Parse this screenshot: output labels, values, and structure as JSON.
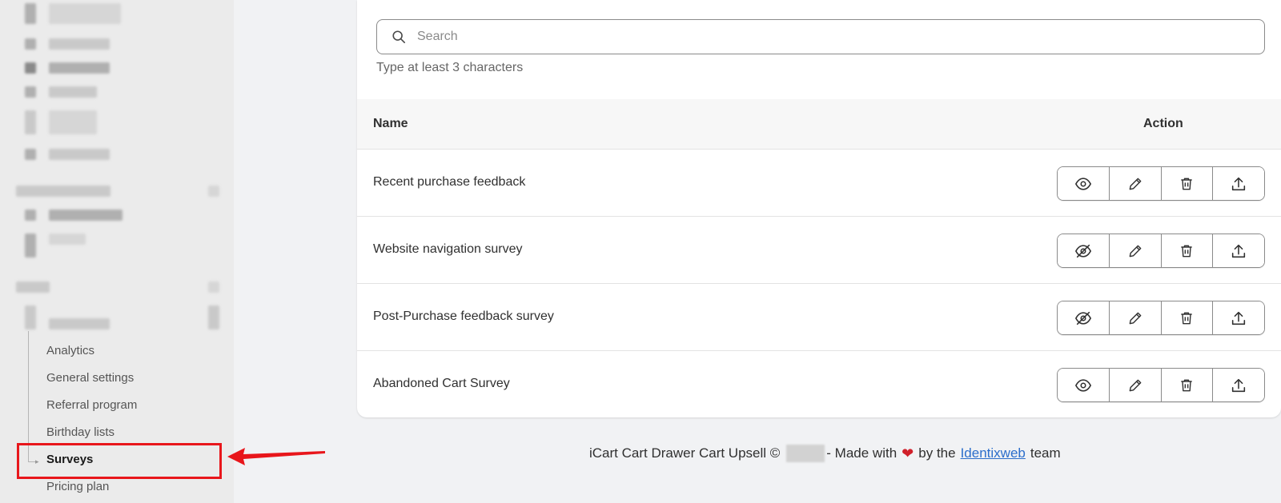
{
  "sidebar": {
    "items": [
      {
        "label": "Analytics"
      },
      {
        "label": "General settings"
      },
      {
        "label": "Referral program"
      },
      {
        "label": "Birthday lists"
      },
      {
        "label": "Surveys"
      },
      {
        "label": "Pricing plan"
      }
    ],
    "active": "Surveys"
  },
  "search": {
    "placeholder": "Search",
    "value": "",
    "hint": "Type at least 3 characters"
  },
  "table": {
    "columns": {
      "name": "Name",
      "action": "Action"
    },
    "rows": [
      {
        "name": "Recent purchase feedback",
        "visible": true
      },
      {
        "name": "Website navigation survey",
        "visible": false
      },
      {
        "name": "Post-Purchase feedback survey",
        "visible": false
      },
      {
        "name": "Abandoned Cart Survey",
        "visible": true
      }
    ]
  },
  "footer": {
    "prefix": "iCart Cart Drawer Cart Upsell ©",
    "made_with": "- Made with",
    "by_the": "by the",
    "link": "Identixweb",
    "suffix": "team"
  },
  "colors": {
    "highlight": "#e8161b",
    "link": "#2c6ecb",
    "heart": "#d0202a"
  }
}
